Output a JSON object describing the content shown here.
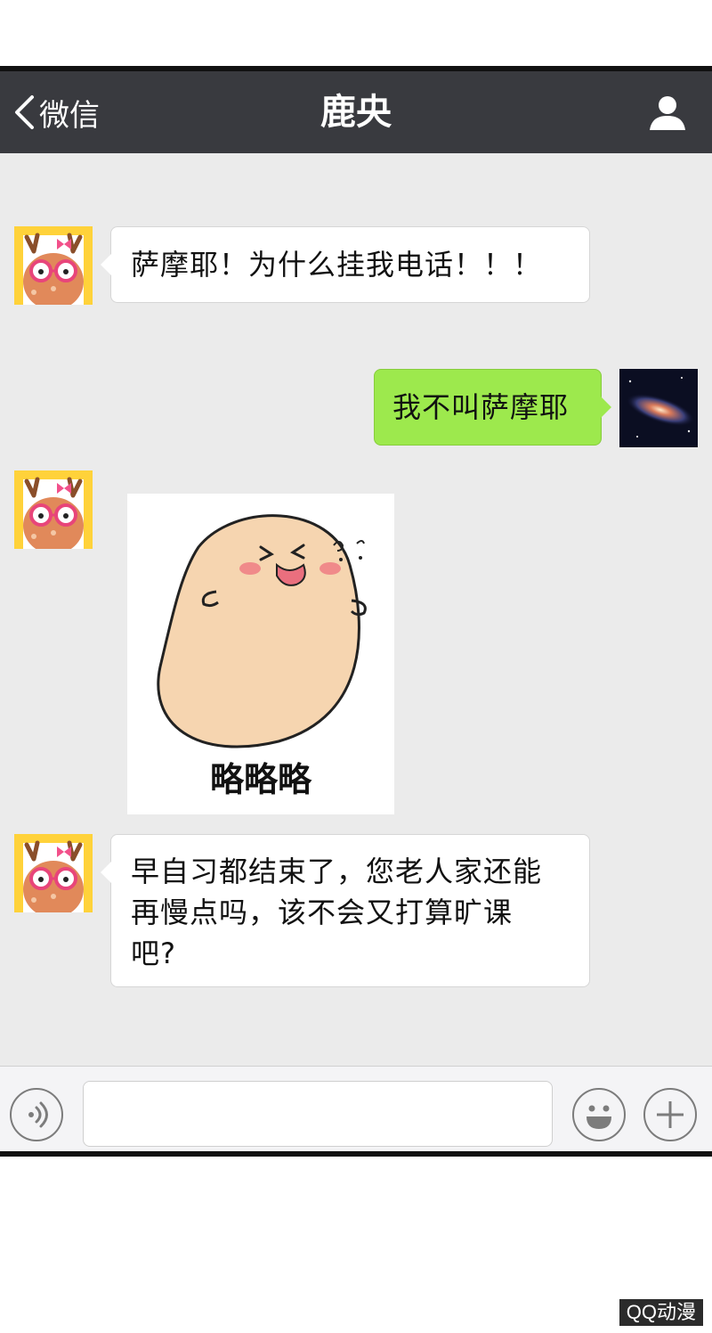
{
  "navbar": {
    "back_label": "微信",
    "title": "鹿央"
  },
  "messages": [
    {
      "from": "contact",
      "text": "萨摩耶！为什么挂我电话！！！"
    },
    {
      "from": "me",
      "text": "我不叫萨摩耶"
    },
    {
      "from": "contact",
      "type": "sticker",
      "caption": "略略略"
    },
    {
      "from": "contact",
      "lines": [
        "早自习都结束了，您老人家还能",
        "再慢点吗，该不会又打算旷课",
        "吧?"
      ]
    }
  ],
  "input": {
    "placeholder": "",
    "value": ""
  },
  "icons": {
    "back": "chevron-left-icon",
    "profile": "person-icon",
    "voice": "voice-icon",
    "emoji": "emoji-icon",
    "more": "plus-icon"
  },
  "colors": {
    "navbar": "#393a3f",
    "chat_background": "#ebebeb",
    "incoming_bubble": "#ffffff",
    "outgoing_bubble": "#9de94d"
  },
  "watermark": "QQ动漫"
}
